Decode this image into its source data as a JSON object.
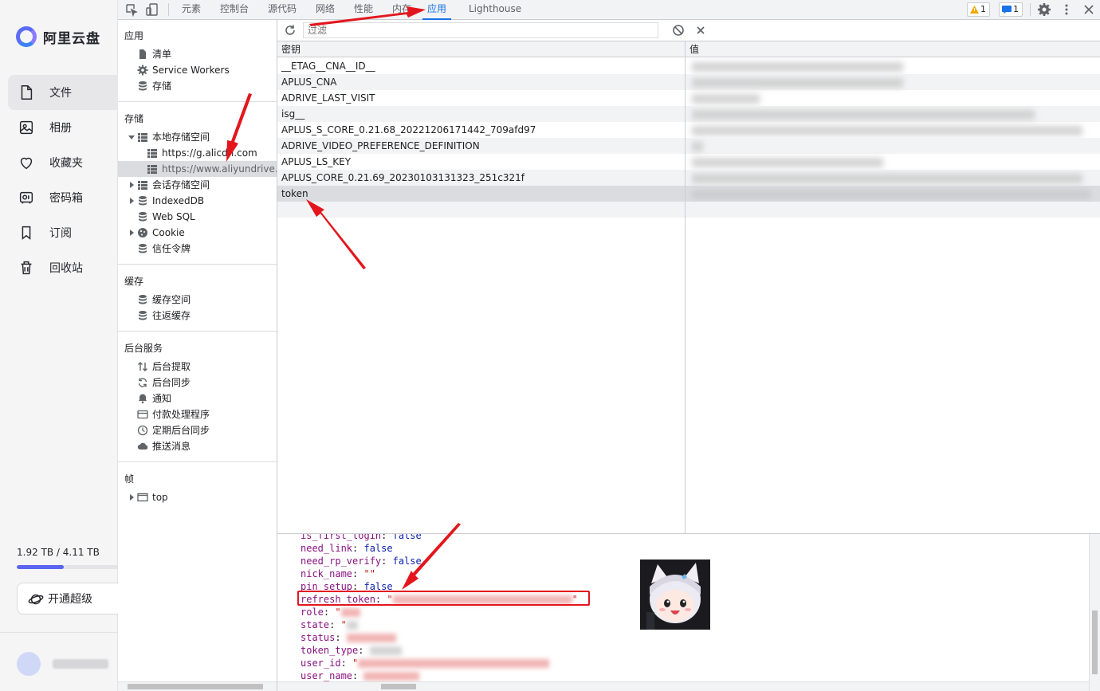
{
  "app": {
    "brand": "阿里云盘",
    "nav": [
      {
        "label": "文件",
        "icon": "file-icon",
        "active": true
      },
      {
        "label": "相册",
        "icon": "photo-icon",
        "active": false
      },
      {
        "label": "收藏夹",
        "icon": "heart-icon",
        "active": false
      },
      {
        "label": "密码箱",
        "icon": "safe-icon",
        "active": false
      },
      {
        "label": "订阅",
        "icon": "bookmark-icon",
        "active": false
      },
      {
        "label": "回收站",
        "icon": "trash-icon",
        "active": false
      }
    ],
    "quota": "1.92 TB / 4.11 TB",
    "quota_fraction": 0.467,
    "vip_button": "开通超级"
  },
  "devtools": {
    "tabs": [
      "元素",
      "控制台",
      "源代码",
      "网络",
      "性能",
      "内存",
      "应用",
      "Lighthouse"
    ],
    "active_tab": "应用",
    "warnings_count": "1",
    "messages_count": "1"
  },
  "tree": {
    "app_section": "应用",
    "app_items": [
      "清单",
      "Service Workers",
      "存储"
    ],
    "storage_section": "存储",
    "local_storage": "本地存储空间",
    "local_origins": [
      "https://g.alicdn.com",
      "https://www.aliyundrive.com"
    ],
    "session_storage": "会话存储空间",
    "indexeddb": "IndexedDB",
    "websql": "Web SQL",
    "cookie": "Cookie",
    "trust_tokens": "信任令牌",
    "cache_section": "缓存",
    "cache_items": [
      "缓存空间",
      "往返缓存"
    ],
    "bg_section": "后台服务",
    "bg_items": [
      "后台提取",
      "后台同步",
      "通知",
      "付款处理程序",
      "定期后台同步",
      "推送消息"
    ],
    "frames_section": "帧",
    "frame_top": "top"
  },
  "storage": {
    "filter_placeholder": "过滤",
    "col_key": "密钥",
    "col_value": "值",
    "rows": [
      "__ETAG__CNA__ID__",
      "APLUS_CNA",
      "ADRIVE_LAST_VISIT",
      "isg__",
      "APLUS_S_CORE_0.21.68_20221206171442_709afd97",
      "ADRIVE_VIDEO_PREFERENCE_DEFINITION",
      "APLUS_LS_KEY",
      "APLUS_CORE_0.21.69_20230103131323_251c321f",
      "token"
    ],
    "selected_row": "token"
  },
  "preview": {
    "lines": [
      {
        "key": "is_first_login",
        "value": "false",
        "type": "bool"
      },
      {
        "key": "need_link",
        "value": "false",
        "type": "bool"
      },
      {
        "key": "need_rp_verify",
        "value": "false",
        "type": "bool"
      },
      {
        "key": "nick_name",
        "value": "\"\"",
        "type": "str"
      },
      {
        "key": "pin_setup",
        "value": "false",
        "type": "bool"
      },
      {
        "key": "refresh_token",
        "value": "\"",
        "type": "redacted"
      },
      {
        "key": "role",
        "value": "\"",
        "type": "redacted"
      },
      {
        "key": "state",
        "value": "\"",
        "type": "redacted"
      },
      {
        "key": "status",
        "value": "",
        "type": "redacted"
      },
      {
        "key": "token_type",
        "value": "",
        "type": "redacted"
      },
      {
        "key": "user_id",
        "value": "\"",
        "type": "redacted"
      },
      {
        "key": "user_name",
        "value": "",
        "type": "redacted"
      }
    ]
  },
  "colors": {
    "accent": "#1a73e8",
    "annotation_red": "#e3161d",
    "brand": "#5a6cf5"
  }
}
